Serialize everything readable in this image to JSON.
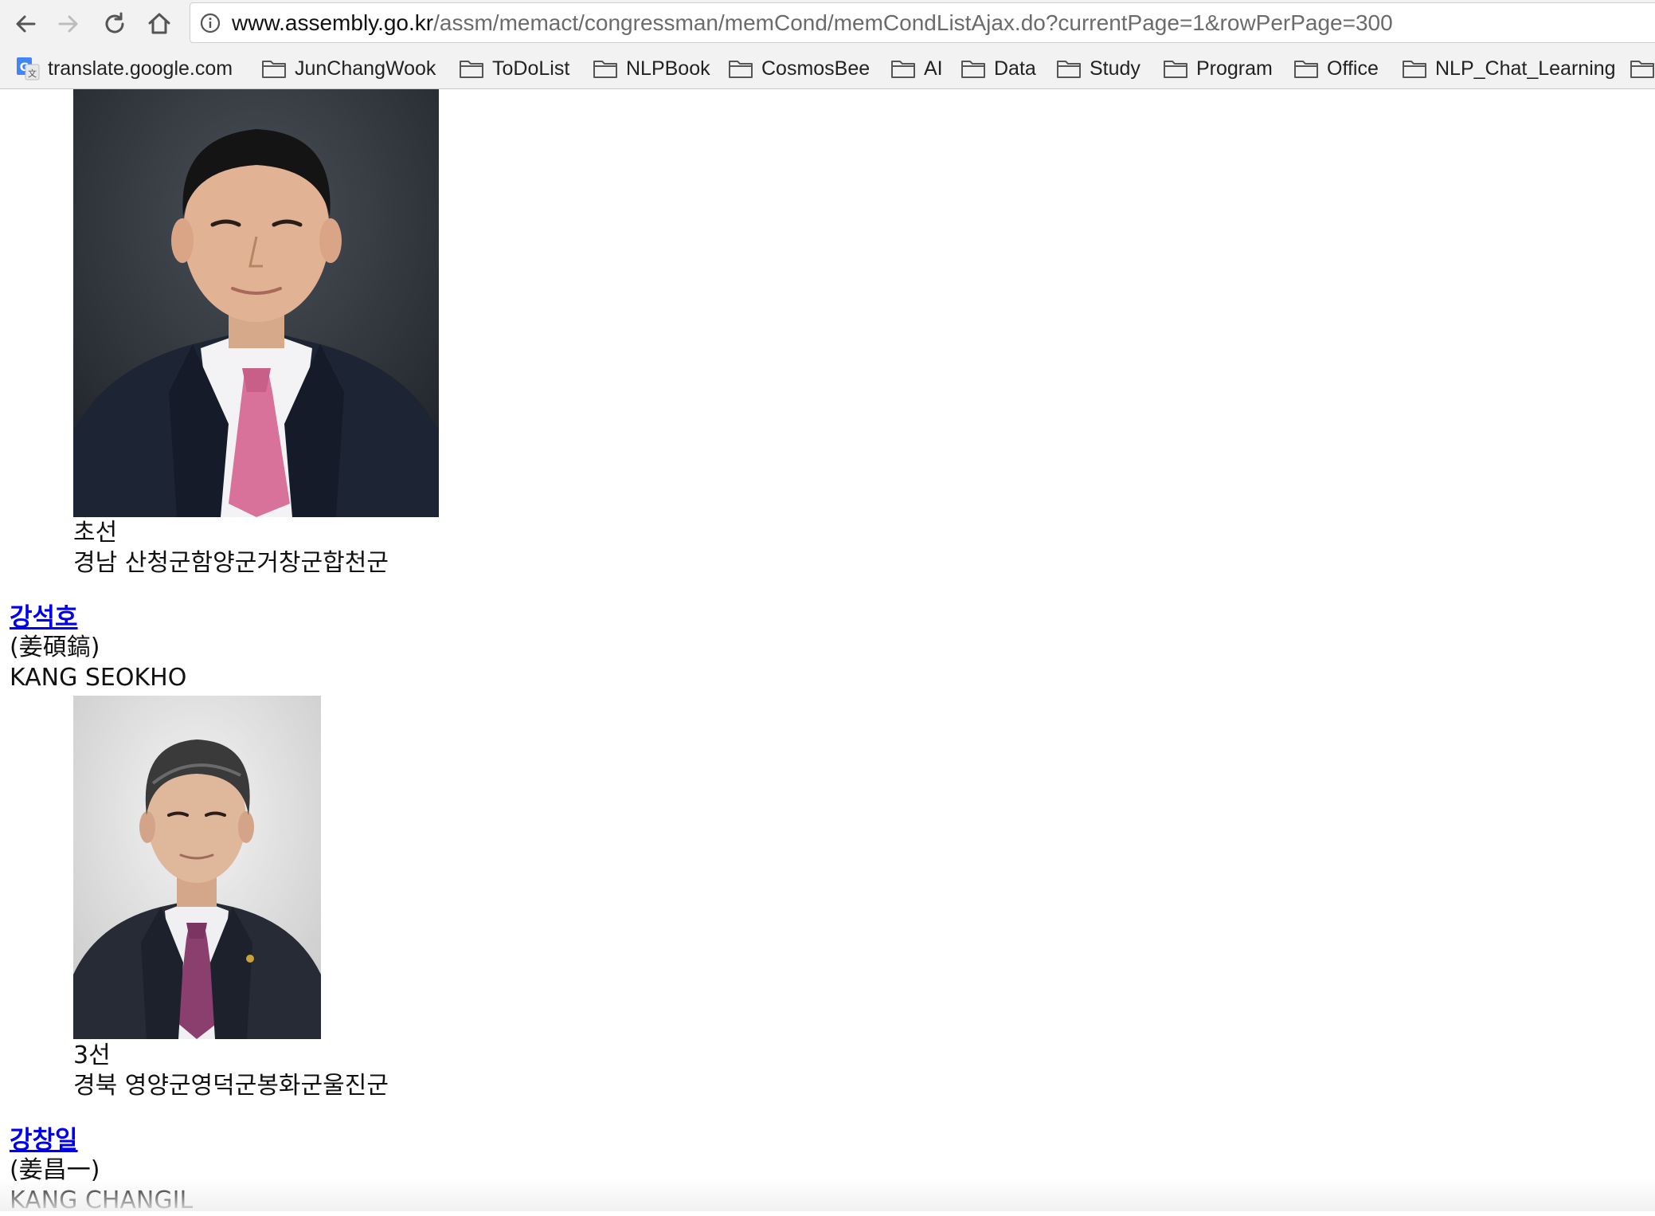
{
  "browser": {
    "url_host": "www.assembly.go.kr",
    "url_path": "/assm/memact/congressman/memCond/memCondListAjax.do?currentPage=1&rowPerPage=300"
  },
  "bookmarks": [
    {
      "label": "translate.google.com",
      "icon": "google-translate-icon"
    },
    {
      "label": "JunChangWook",
      "icon": "folder-icon"
    },
    {
      "label": "ToDoList",
      "icon": "folder-icon"
    },
    {
      "label": "NLPBook",
      "icon": "folder-icon"
    },
    {
      "label": "CosmosBee",
      "icon": "folder-icon"
    },
    {
      "label": "AI",
      "icon": "folder-icon"
    },
    {
      "label": "Data",
      "icon": "folder-icon"
    },
    {
      "label": "Study",
      "icon": "folder-icon"
    },
    {
      "label": "Program",
      "icon": "folder-icon"
    },
    {
      "label": "Office",
      "icon": "folder-icon"
    },
    {
      "label": "NLP_Chat_Learning",
      "icon": "folder-icon"
    }
  ],
  "members": [
    {
      "term": "초선",
      "district": "경남 산청군함양군거창군합천군"
    },
    {
      "name": "강석호",
      "hanja": "(姜碩鎬)",
      "english": "KANG SEOKHO",
      "term": "3선",
      "district": "경북 영양군영덕군봉화군울진군"
    },
    {
      "name": "강창일",
      "hanja": "(姜昌一)",
      "english": "KANG CHANGIL"
    }
  ],
  "colors": {
    "link": "#0000ee",
    "chrome": "#f2f2f2",
    "suit_dark": "#1d2433",
    "tie_pink": "#d9729a",
    "tie_purple": "#8a3f6e"
  }
}
